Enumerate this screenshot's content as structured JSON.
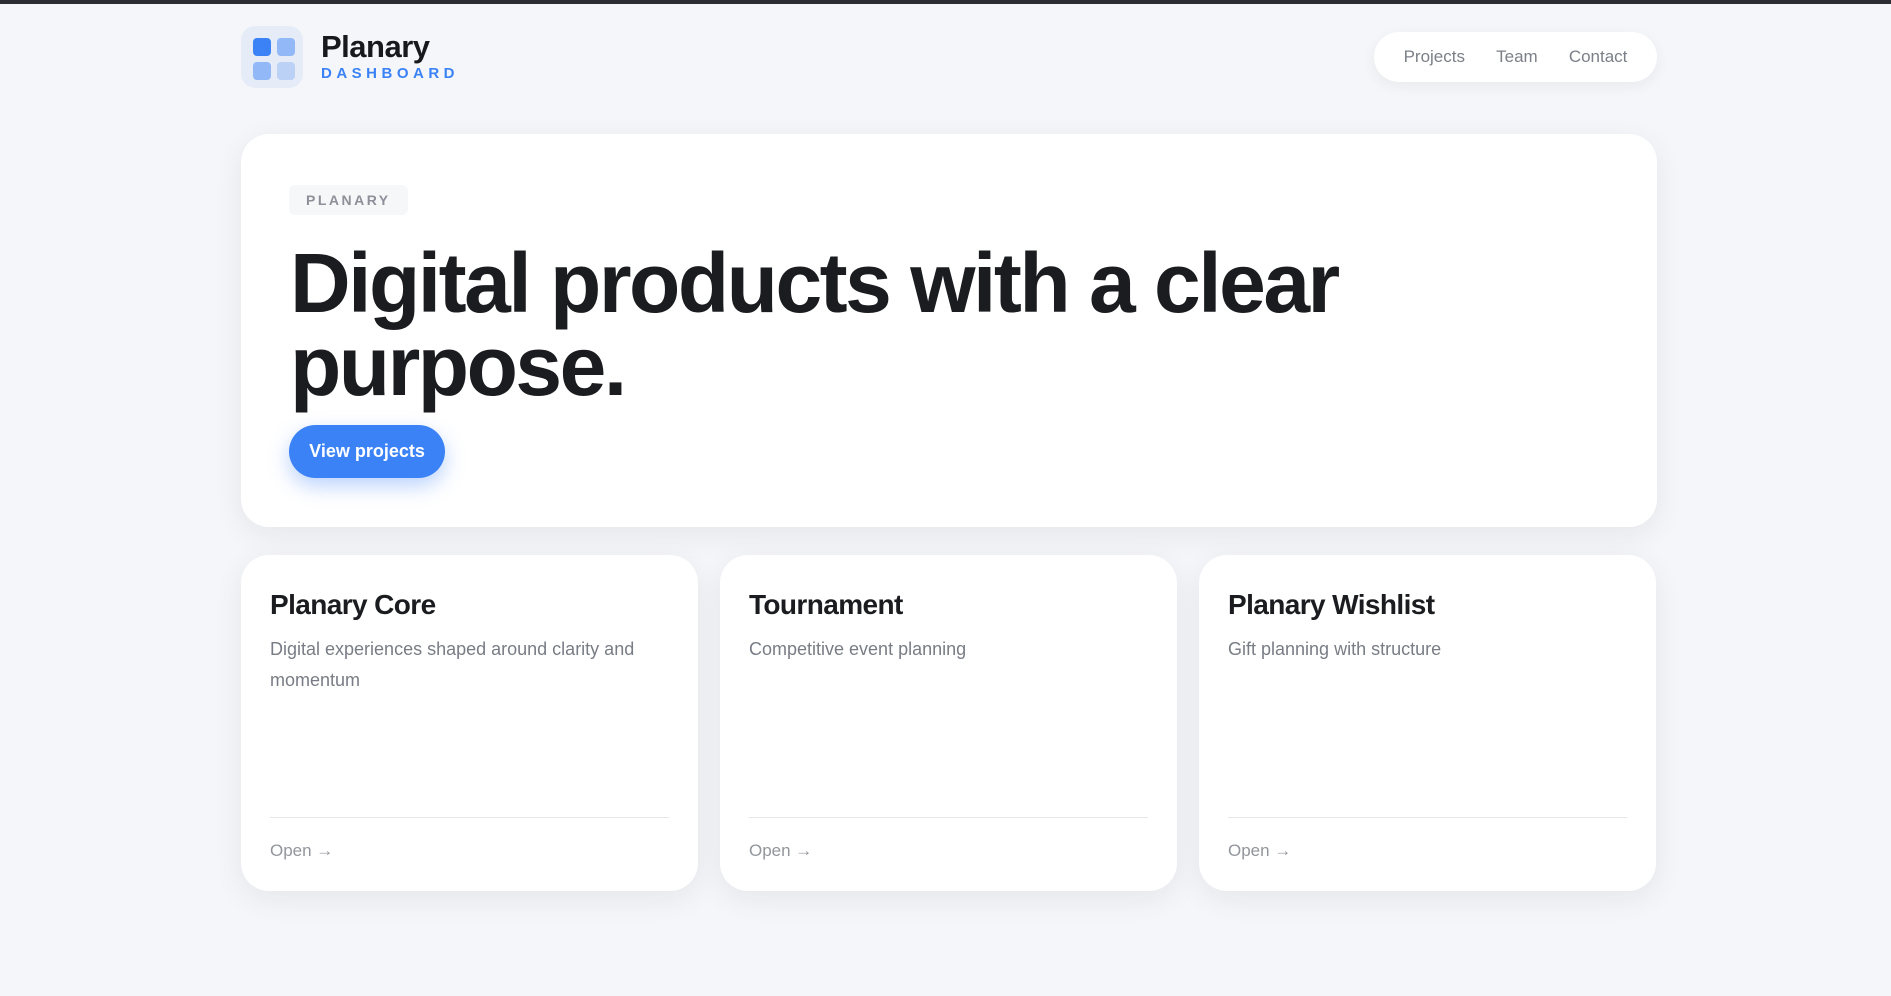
{
  "brand": {
    "name": "Planary",
    "subtitle": "DASHBOARD",
    "accent": "#3b82f6"
  },
  "nav": {
    "items": [
      {
        "label": "Projects"
      },
      {
        "label": "Team"
      },
      {
        "label": "Contact"
      }
    ]
  },
  "hero": {
    "eyebrow": "PLANARY",
    "title": "Digital products with a clear purpose.",
    "cta_label": "View projects"
  },
  "cards": [
    {
      "title": "Planary Core",
      "description": "Digital experiences shaped around clarity and momentum",
      "link": "Open →"
    },
    {
      "title": "Tournament",
      "description": "Competitive event planning",
      "link": "Open →"
    },
    {
      "title": "Planary Wishlist",
      "description": "Gift planning with structure",
      "link": "Open →"
    }
  ]
}
